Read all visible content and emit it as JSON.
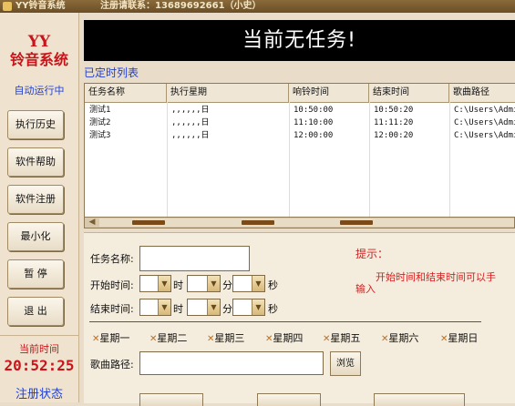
{
  "titlebar": {
    "title": "YY铃音系统",
    "contact": "注册请联系：13689692661（小史）"
  },
  "sidebar": {
    "logo_line1": "YY",
    "logo_line2": "铃音系统",
    "auto_run": "自动运行中",
    "buttons": [
      "执行历史",
      "软件帮助",
      "软件注册",
      "最小化",
      "暂 停",
      "退 出"
    ],
    "clock_label": "当前时间",
    "clock": "20:52:25",
    "reg_status": "注册状态"
  },
  "banner": "当前无任务!",
  "schedule": {
    "title": "已定时列表",
    "columns": [
      "任务名称",
      "执行星期",
      "响铃时间",
      "结束时间",
      "歌曲路径"
    ],
    "rows": [
      [
        "测试1",
        ",,,,,,日",
        "10:50:00",
        "10:50:20",
        "C:\\Users\\Admi"
      ],
      [
        "测试2",
        ",,,,,,日",
        "11:10:00",
        "11:11:20",
        "C:\\Users\\Admi"
      ],
      [
        "测试3",
        ",,,,,,日",
        "12:00:00",
        "12:00:20",
        "C:\\Users\\Admi"
      ]
    ]
  },
  "form": {
    "task_name_label": "任务名称:",
    "task_name_value": "",
    "start_label": "开始时间:",
    "end_label": "结束时间:",
    "hour_unit": "时",
    "minute_unit": "分",
    "second_unit": "秒",
    "hint_title": "提示：",
    "hint_line1": "开始时间和结束时间可以手",
    "hint_line2": "输入",
    "weekdays": [
      "星期一",
      "星期二",
      "星期三",
      "星期四",
      "星期五",
      "星期六",
      "星期日"
    ],
    "weekday_mark": "✕",
    "song_path_label": "歌曲路径:",
    "song_path_value": "",
    "browse_label": "浏览"
  },
  "colors": {
    "accent_red": "#c8141a",
    "accent_blue": "#1f3fd0",
    "banner_bg": "#000000"
  }
}
